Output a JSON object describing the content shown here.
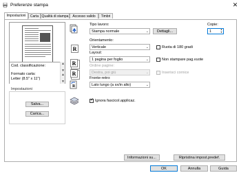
{
  "window": {
    "title": "Preferenze stampa"
  },
  "tabs": [
    {
      "label": "Impostazioni",
      "active": true
    },
    {
      "label": "Carta"
    },
    {
      "label": "Qualità di stampa"
    },
    {
      "label": "Accesso valido"
    },
    {
      "label": "Timbri"
    }
  ],
  "preview": {
    "info_lines": [
      "Cod. classificazione:",
      "Formato carta:",
      "Letter (8.5\" x 11\")"
    ]
  },
  "settings_group": {
    "title": "Impostazioni",
    "save_label": "Salva...",
    "load_label": "Carica..."
  },
  "job": {
    "type_label": "Tipo lavoro:",
    "type_value": "Stampa normale",
    "details_label": "Dettagli...",
    "copies_label": "Copie:",
    "copies_value": "1"
  },
  "orientation": {
    "label": "Orientamento:",
    "value": "Verticale",
    "rotate_label": "Ruota di 180 gradi",
    "rotate_checked": false
  },
  "layout": {
    "label": "Layout:",
    "value": "1 pagina per foglio",
    "blank_pages_label": "Non stampare pag.vuote",
    "blank_pages_checked": false,
    "page_order_label": "Ordine pagine:",
    "page_order_value": "Destra, poi giù",
    "border_label": "Inserisci cornice",
    "border_checked": false
  },
  "duplex": {
    "label": "Fronte-retro:",
    "value": "Lato lungo (a sx/in alto)"
  },
  "ignore_paper": {
    "label": "Ignora fascicol.applicaz.",
    "checked": true
  },
  "bottom": {
    "info_label": "Informazioni su...",
    "restore_label": "Ripristina impost.predef.",
    "ok_label": "OK",
    "cancel_label": "Annulla",
    "help_label": "Guida"
  }
}
